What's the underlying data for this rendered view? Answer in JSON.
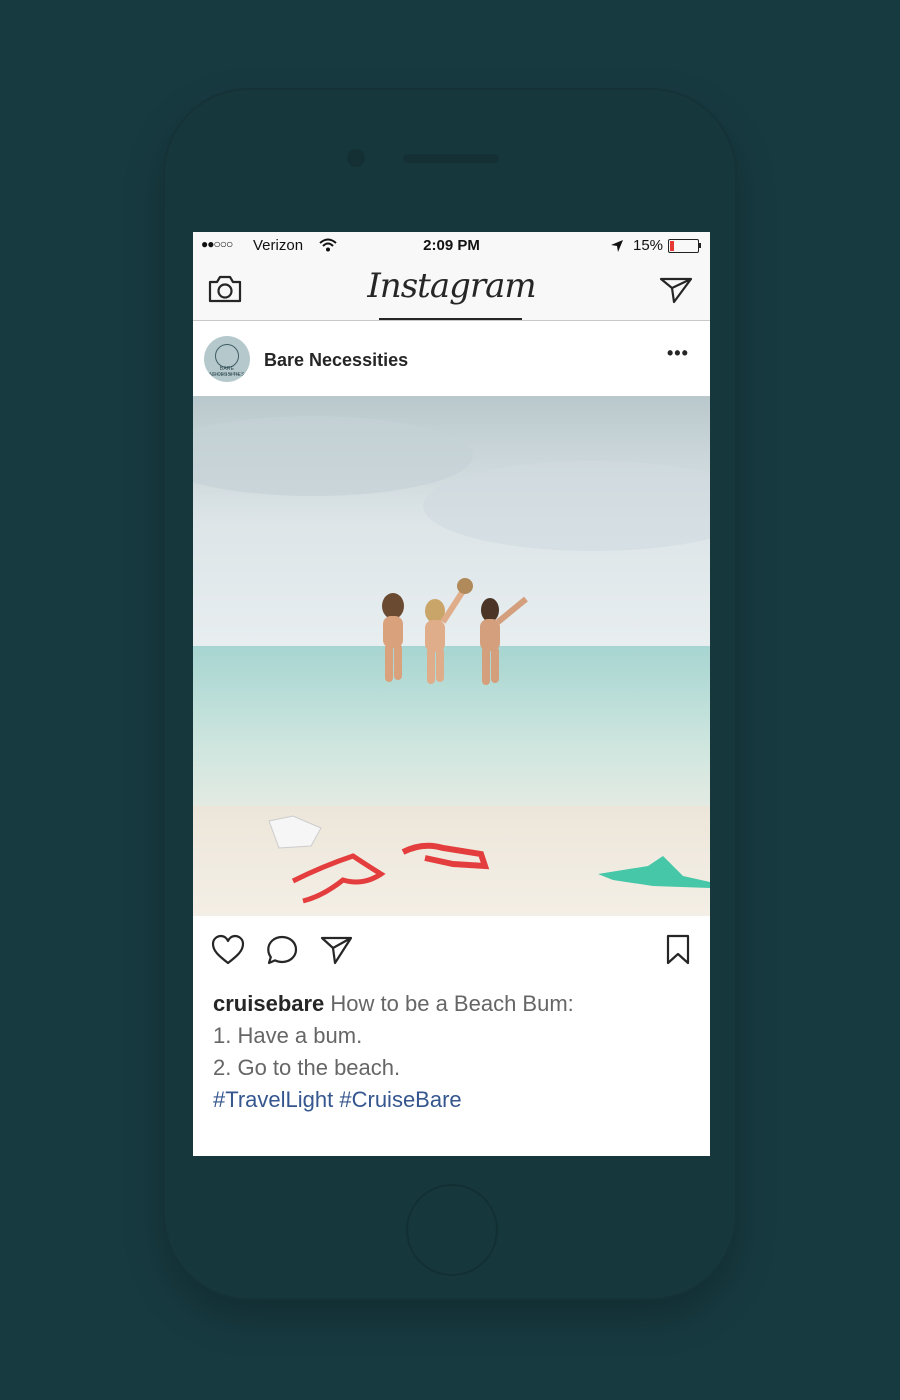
{
  "status_bar": {
    "signal_dots": "●●○○○",
    "carrier": "Verizon",
    "time": "2:09 PM",
    "battery_percent": "15%",
    "battery_level": 0.15,
    "battery_color": "#e53935"
  },
  "nav": {
    "brand": "Instagram",
    "camera_icon": "camera-icon",
    "direct_icon": "paper-plane-icon"
  },
  "post": {
    "account_name": "Bare Necessities",
    "avatar_text_main": "BARE NECESSITIES",
    "avatar_text_sub": "TOURS & TRAVEL",
    "more_label": "•••",
    "actions": [
      "heart-icon",
      "comment-icon",
      "share-icon",
      "bookmark-icon"
    ],
    "caption": {
      "username": "cruisebare",
      "line1": "How to be a Beach Bum:",
      "line2": "1. Have a bum.",
      "line3": "2. Go to the beach.",
      "hashtag1": "#TravelLight",
      "hashtag2": "#CruiseBare"
    }
  },
  "colors": {
    "background": "#173a40",
    "hashtag": "#35568e",
    "text": "#262626"
  }
}
